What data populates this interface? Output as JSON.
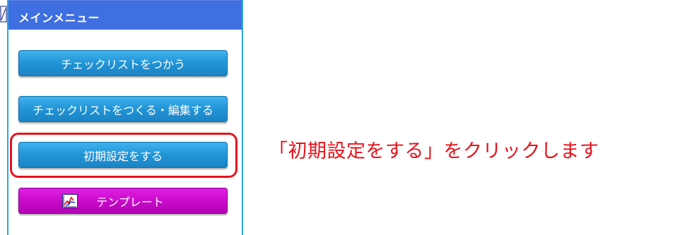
{
  "menu": {
    "title": "メインメニュー",
    "buttons": [
      {
        "label": "チェックリストをつかう",
        "color": "#2294d6"
      },
      {
        "label": "チェックリストをつくる・編集する",
        "color": "#2294d6"
      },
      {
        "label": "初期設定をする",
        "color": "#2294d6"
      },
      {
        "label": "テンプレート",
        "color": "#c70ac9",
        "icon": "chart-icon"
      }
    ],
    "header_color": "#3f6fe0",
    "border_color": "#2fa6df"
  },
  "annotation": {
    "text": "「初期設定をする」をクリックします",
    "color": "#e8121b",
    "highlighted_button": "初期設定をする"
  }
}
